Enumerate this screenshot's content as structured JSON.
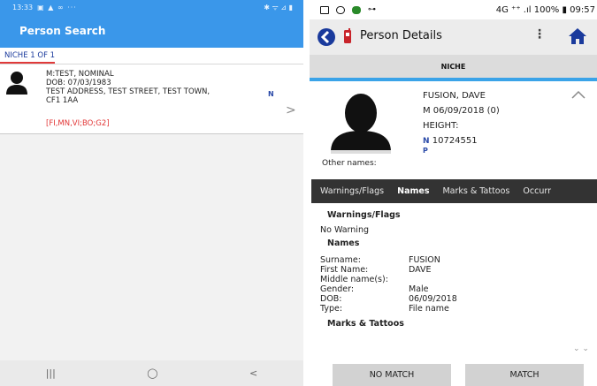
{
  "left": {
    "status_time": "13:33",
    "status_left_icons": "▣ ▲ ∞ ···",
    "status_right_icons": "✱ ᯤ ⊿ ▮",
    "app_title": "Person Search",
    "tab_label": "NICHE 1 OF 1",
    "record": {
      "line1": "M:TEST,  NOMINAL",
      "line2": "DOB: 07/03/1983",
      "line3": "TEST ADDRESS, TEST STREET, TEST TOWN,",
      "line4": "CF1 1AA",
      "warnings": "[FI,MN,VI;BO;G2]",
      "nominal_mark": "N"
    },
    "nav": {
      "recent": "|||",
      "home": "◯",
      "back": "<"
    }
  },
  "right": {
    "status_right": "4G ⁺⁺ .ıl 100% ▮ 09:57",
    "header_title": "Person Details",
    "more_icon": "⋮",
    "niche_label": "NICHE",
    "person": {
      "name": "FUSION, DAVE",
      "sex_dob": "M 06/09/2018 (0)",
      "height": "HEIGHT:",
      "n_label": "N",
      "number": "10724551",
      "p_label": "P",
      "other_names": "Other names:"
    },
    "tabs": [
      "Warnings/Flags",
      "Names",
      "Marks & Tattoos",
      "Occurr"
    ],
    "sections": {
      "warnings_title": "Warnings/Flags",
      "no_warning": "No Warning",
      "names_title": "Names",
      "marks_title": "Marks & Tattoos"
    },
    "names": [
      {
        "k": "Surname:",
        "v": "FUSION"
      },
      {
        "k": "First Name:",
        "v": "DAVE"
      },
      {
        "k": "Middle name(s):",
        "v": ""
      },
      {
        "k": "Gender:",
        "v": "Male"
      },
      {
        "k": "DOB:",
        "v": "06/09/2018"
      },
      {
        "k": "Type:",
        "v": "File name"
      }
    ],
    "scroll_indicator": "⌄ ⌄",
    "buttons": {
      "no_match": "NO MATCH",
      "match": "MATCH"
    }
  },
  "colors": {
    "accent_blue": "#3a97ea",
    "warning_red": "#e23535",
    "tab_bar": "#333333",
    "back_icon": "#1a3a9c"
  }
}
